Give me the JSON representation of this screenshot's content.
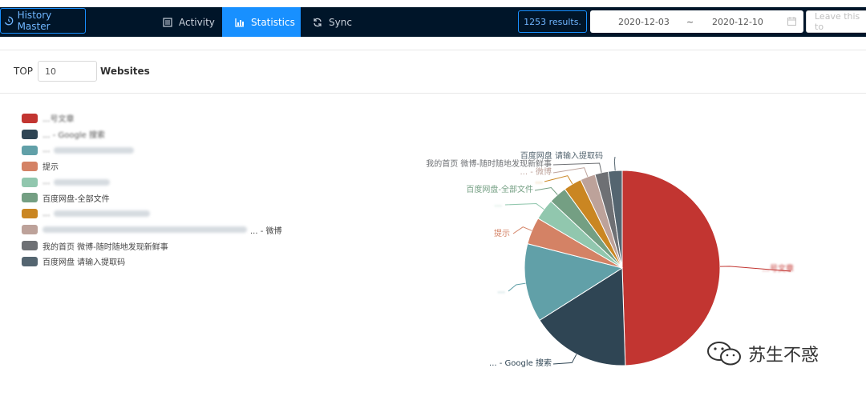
{
  "navbar": {
    "brand": "History Master",
    "tabs": [
      {
        "label": "Activity",
        "icon": "list-icon"
      },
      {
        "label": "Statistics",
        "icon": "bar-chart-icon"
      },
      {
        "label": "Sync",
        "icon": "sync-icon"
      }
    ],
    "results": "1253 results.",
    "date_start": "2020-12-03",
    "date_separator": "~",
    "date_end": "2020-12-10",
    "filter_placeholder": "Leave this to"
  },
  "top": {
    "prefix": "TOP",
    "value": "10",
    "suffix": "Websites"
  },
  "chart_data": {
    "type": "pie",
    "legend_position": "left",
    "slices": [
      {
        "label": "...号文章",
        "value": 49.5,
        "color": "#c23531"
      },
      {
        "label": "... - Google 搜索",
        "value": 16.5,
        "color": "#2f4554"
      },
      {
        "label": "...",
        "value": 13.0,
        "color": "#61a0a8"
      },
      {
        "label": "提示",
        "value": 4.5,
        "color": "#d48265"
      },
      {
        "label": "...",
        "value": 3.5,
        "color": "#91c7ae"
      },
      {
        "label": "百度网盘-全部文件",
        "value": 3.0,
        "color": "#749f83"
      },
      {
        "label": "...",
        "value": 3.0,
        "color": "#ca8622"
      },
      {
        "label": "... - 微博",
        "value": 2.5,
        "color": "#bda29a"
      },
      {
        "label": "我的首页 微博-随时随地发现新鲜事",
        "value": 2.2,
        "color": "#6e7074"
      },
      {
        "label": "百度网盘 请输入提取码",
        "value": 2.3,
        "color": "#546570"
      }
    ]
  },
  "watermark": "苏生不惑"
}
